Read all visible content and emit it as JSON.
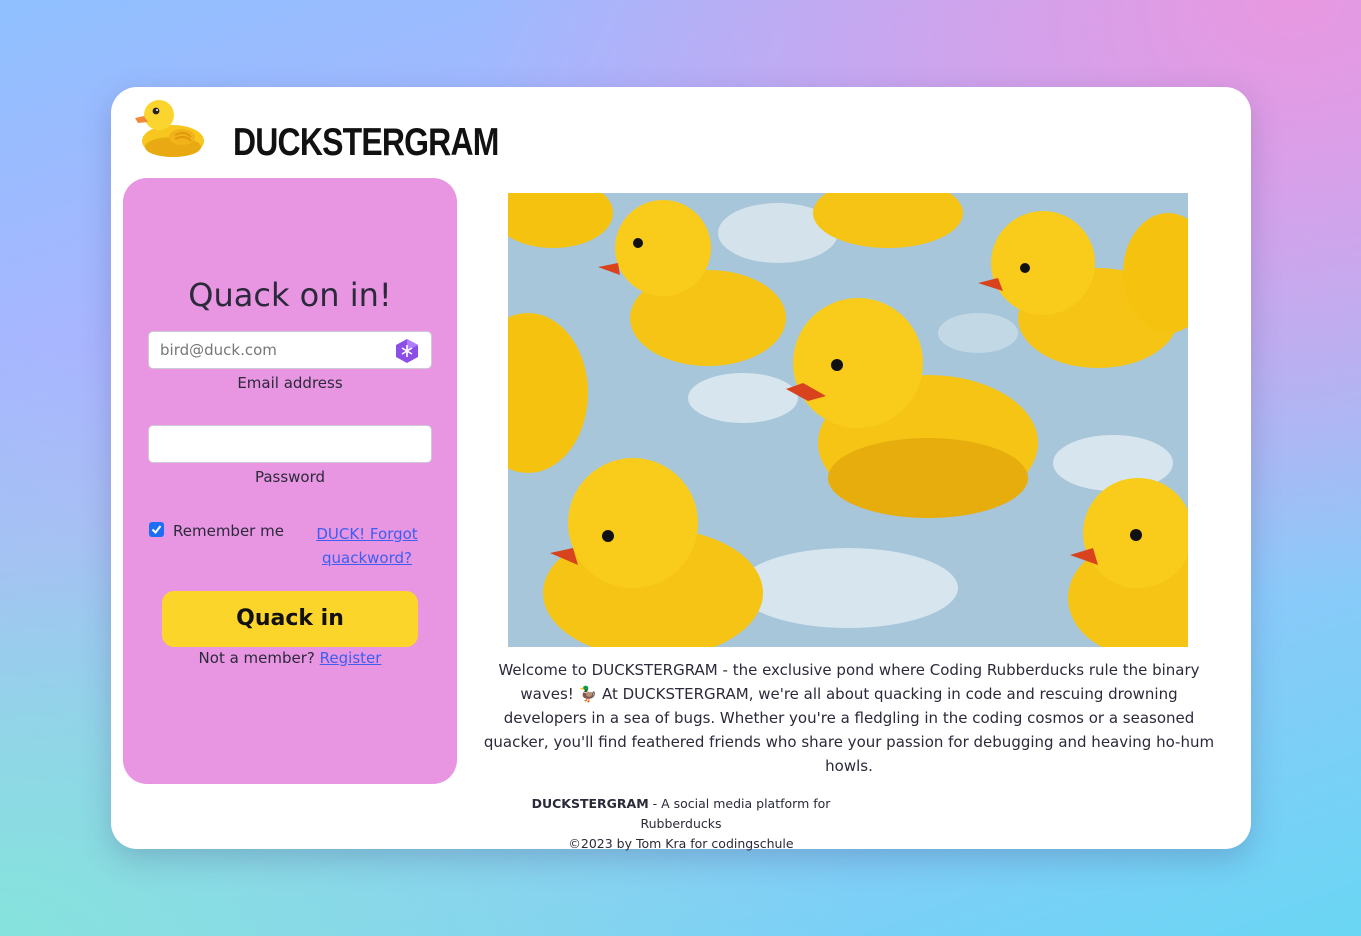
{
  "brand": {
    "name": "DUCKSTERGRAM"
  },
  "login": {
    "title": "Quack on in!",
    "email_placeholder": "bird@duck.com",
    "email_label": "Email address",
    "password_label": "Password",
    "remember_label": "Remember me",
    "remember_checked": true,
    "forgot_link": "DUCK! Forgot quackword?",
    "submit_label": "Quack in",
    "not_member_text": "Not a member?",
    "register_link": "Register"
  },
  "main": {
    "description": "Welcome to DUCKSTERGRAM - the exclusive pond where Coding Rubberducks rule the binary waves! 🦆 At DUCKSTERGRAM, we're all about quacking in code and rescuing drowning developers in a sea of bugs. Whether you're a fledgling in the coding cosmos or a seasoned quacker, you'll find feathered friends who share your passion for debugging and heaving ho-hum howls."
  },
  "footer": {
    "brand": "DUCKSTERGRAM",
    "tagline": " - A social media platform for Rubberducks",
    "copyright": "©2023 by Tom Kra for codingschule"
  },
  "colors": {
    "accent_button": "#fcd52b",
    "login_panel": "#e895e2",
    "link": "#3b5ff0"
  }
}
